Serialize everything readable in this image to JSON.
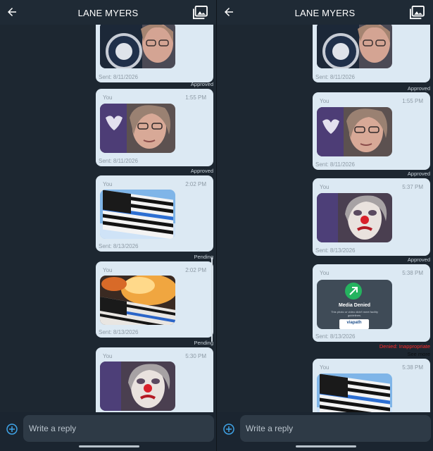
{
  "header": {
    "title": "LANE MYERS"
  },
  "composer": {
    "placeholder": "Write a reply"
  },
  "left_thread": [
    {
      "sender": "",
      "time": "",
      "sent": "Sent: 8/11/2026",
      "status": "Approved",
      "photo": "woman-reallyco-photo"
    },
    {
      "sender": "You",
      "time": "1:55 PM",
      "sent": "Sent: 8/11/2026",
      "status": "Approved",
      "photo": "woman-selfie-photo"
    },
    {
      "sender": "You",
      "time": "2:02 PM",
      "sent": "Sent: 8/13/2026",
      "status": "Pending",
      "photo": "thin-blue-line-flag-photo"
    },
    {
      "sender": "You",
      "time": "2:02 PM",
      "sent": "Sent: 8/13/2026",
      "status": "Pending",
      "photo": "burning-flag-photo"
    },
    {
      "sender": "You",
      "time": "5:30 PM",
      "sent": "",
      "status": "",
      "photo": "clown-makeup-photo"
    }
  ],
  "right_thread": [
    {
      "sender": "",
      "time": "",
      "sent": "Sent: 8/11/2026",
      "status": "Approved",
      "photo": "woman-reallyco-photo"
    },
    {
      "sender": "You",
      "time": "1:55 PM",
      "sent": "Sent: 8/11/2026",
      "status": "Approved",
      "photo": "woman-selfie-photo"
    },
    {
      "sender": "You",
      "time": "5:37 PM",
      "sent": "Sent: 8/13/2026",
      "status": "Approved",
      "photo": "clown-makeup-photo"
    },
    {
      "sender": "You",
      "time": "5:38 PM",
      "sent": "Sent: 8/13/2026",
      "status": "Denied: Inappropriate",
      "see_more": "See more",
      "photo": "media-denied-card",
      "denied": {
        "title": "Media Denied",
        "subtitle": "This photo or video didn't meet facility guidelines.",
        "logo": "viapath"
      }
    },
    {
      "sender": "You",
      "time": "5:38 PM",
      "sent": "",
      "status": "",
      "photo": "thin-blue-line-flag-photo"
    }
  ],
  "colors": {
    "background": "#1d2731",
    "bubble": "#dce9f3",
    "denied_status": "#ff2b2b",
    "accent_plus": "#3fa3e6"
  }
}
